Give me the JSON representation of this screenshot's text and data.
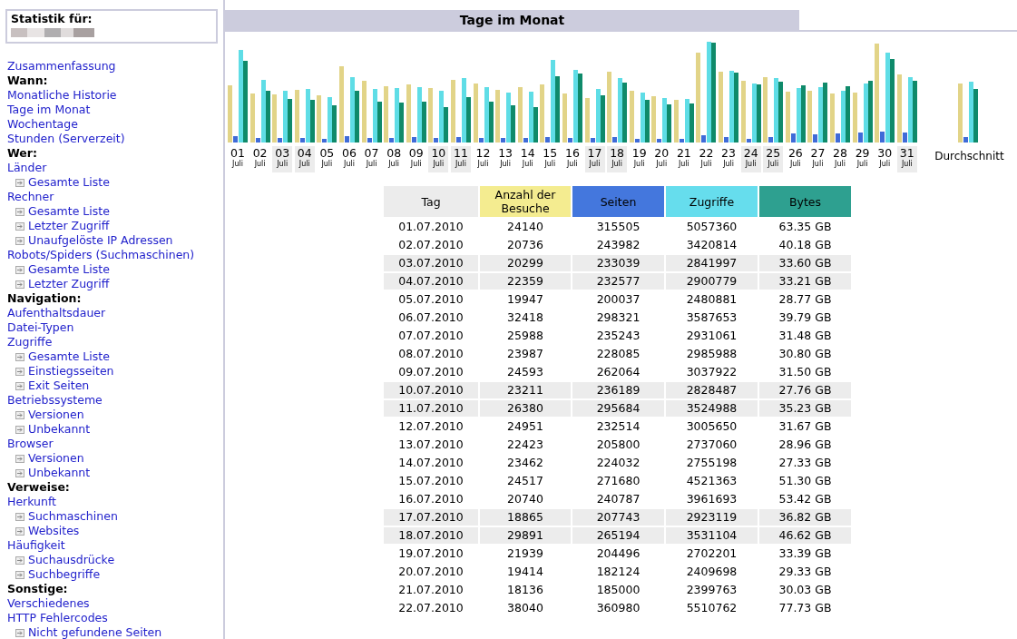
{
  "sidebar": {
    "title": "Statistik für:",
    "items": [
      {
        "kind": "link",
        "label": "Zusammenfassung"
      },
      {
        "kind": "heading",
        "label": "Wann:"
      },
      {
        "kind": "link",
        "label": "Monatliche Historie"
      },
      {
        "kind": "link",
        "label": "Tage im Monat"
      },
      {
        "kind": "link",
        "label": "Wochentage"
      },
      {
        "kind": "link",
        "label": "Stunden (Serverzeit)"
      },
      {
        "kind": "heading",
        "label": "Wer:"
      },
      {
        "kind": "link",
        "label": "Länder"
      },
      {
        "kind": "sublink",
        "label": "Gesamte Liste"
      },
      {
        "kind": "link",
        "label": "Rechner"
      },
      {
        "kind": "sublink",
        "label": "Gesamte Liste"
      },
      {
        "kind": "sublink",
        "label": "Letzter Zugriff"
      },
      {
        "kind": "sublink",
        "label": "Unaufgelöste IP Adressen"
      },
      {
        "kind": "link",
        "label": "Robots/Spiders (Suchmaschinen)"
      },
      {
        "kind": "sublink",
        "label": "Gesamte Liste"
      },
      {
        "kind": "sublink",
        "label": "Letzter Zugriff"
      },
      {
        "kind": "heading",
        "label": "Navigation:"
      },
      {
        "kind": "link",
        "label": "Aufenthaltsdauer"
      },
      {
        "kind": "link",
        "label": "Datei-Typen"
      },
      {
        "kind": "link",
        "label": "Zugriffe"
      },
      {
        "kind": "sublink",
        "label": "Gesamte Liste"
      },
      {
        "kind": "sublink",
        "label": "Einstiegsseiten"
      },
      {
        "kind": "sublink",
        "label": "Exit Seiten"
      },
      {
        "kind": "link",
        "label": "Betriebssysteme"
      },
      {
        "kind": "sublink",
        "label": "Versionen"
      },
      {
        "kind": "sublink",
        "label": "Unbekannt"
      },
      {
        "kind": "link",
        "label": "Browser"
      },
      {
        "kind": "sublink",
        "label": "Versionen"
      },
      {
        "kind": "sublink",
        "label": "Unbekannt"
      },
      {
        "kind": "heading",
        "label": "Verweise:"
      },
      {
        "kind": "link",
        "label": "Herkunft"
      },
      {
        "kind": "sublink",
        "label": "Suchmaschinen"
      },
      {
        "kind": "sublink",
        "label": "Websites"
      },
      {
        "kind": "link",
        "label": "Häufigkeit"
      },
      {
        "kind": "sublink",
        "label": "Suchausdrücke"
      },
      {
        "kind": "sublink",
        "label": "Suchbegriffe"
      },
      {
        "kind": "heading",
        "label": "Sonstige:"
      },
      {
        "kind": "link",
        "label": "Verschiedenes"
      },
      {
        "kind": "link",
        "label": "HTTP Fehlercodes"
      },
      {
        "kind": "sublink",
        "label": "Nicht gefundene Seiten"
      }
    ]
  },
  "section_title": "Tage im Monat",
  "chart": {
    "days": [
      {
        "day": "01",
        "month": "Juli",
        "weekend": false
      },
      {
        "day": "02",
        "month": "Juli",
        "weekend": false
      },
      {
        "day": "03",
        "month": "Juli",
        "weekend": true
      },
      {
        "day": "04",
        "month": "Juli",
        "weekend": true
      },
      {
        "day": "05",
        "month": "Juli",
        "weekend": false
      },
      {
        "day": "06",
        "month": "Juli",
        "weekend": false
      },
      {
        "day": "07",
        "month": "Juli",
        "weekend": false
      },
      {
        "day": "08",
        "month": "Juli",
        "weekend": false
      },
      {
        "day": "09",
        "month": "Juli",
        "weekend": false
      },
      {
        "day": "10",
        "month": "Juli",
        "weekend": true
      },
      {
        "day": "11",
        "month": "Juli",
        "weekend": true
      },
      {
        "day": "12",
        "month": "Juli",
        "weekend": false
      },
      {
        "day": "13",
        "month": "Juli",
        "weekend": false
      },
      {
        "day": "14",
        "month": "Juli",
        "weekend": false
      },
      {
        "day": "15",
        "month": "Juli",
        "weekend": false
      },
      {
        "day": "16",
        "month": "Juli",
        "weekend": false
      },
      {
        "day": "17",
        "month": "Juli",
        "weekend": true
      },
      {
        "day": "18",
        "month": "Juli",
        "weekend": true
      },
      {
        "day": "19",
        "month": "Juli",
        "weekend": false
      },
      {
        "day": "20",
        "month": "Juli",
        "weekend": false
      },
      {
        "day": "21",
        "month": "Juli",
        "weekend": false
      },
      {
        "day": "22",
        "month": "Juli",
        "weekend": false
      },
      {
        "day": "23",
        "month": "Juli",
        "weekend": false
      },
      {
        "day": "24",
        "month": "Juli",
        "weekend": true
      },
      {
        "day": "25",
        "month": "Juli",
        "weekend": true
      },
      {
        "day": "26",
        "month": "Juli",
        "weekend": false
      },
      {
        "day": "27",
        "month": "Juli",
        "weekend": false
      },
      {
        "day": "28",
        "month": "Juli",
        "weekend": false
      },
      {
        "day": "29",
        "month": "Juli",
        "weekend": false
      },
      {
        "day": "30",
        "month": "Juli",
        "weekend": false
      },
      {
        "day": "31",
        "month": "Juli",
        "weekend": true
      }
    ],
    "average_label": "Durchschnitt"
  },
  "table": {
    "columns": [
      "Tag",
      "Anzahl der Besuche",
      "Seiten",
      "Zugriffe",
      "Bytes"
    ],
    "rows": [
      {
        "weekend": false,
        "cells": [
          "01.07.2010",
          "24140",
          "315505",
          "5057360",
          "63.35 GB"
        ]
      },
      {
        "weekend": false,
        "cells": [
          "02.07.2010",
          "20736",
          "243982",
          "3420814",
          "40.18 GB"
        ]
      },
      {
        "weekend": true,
        "cells": [
          "03.07.2010",
          "20299",
          "233039",
          "2841997",
          "33.60 GB"
        ]
      },
      {
        "weekend": true,
        "cells": [
          "04.07.2010",
          "22359",
          "232577",
          "2900779",
          "33.21 GB"
        ]
      },
      {
        "weekend": false,
        "cells": [
          "05.07.2010",
          "19947",
          "200037",
          "2480881",
          "28.77 GB"
        ]
      },
      {
        "weekend": false,
        "cells": [
          "06.07.2010",
          "32418",
          "298321",
          "3587653",
          "39.79 GB"
        ]
      },
      {
        "weekend": false,
        "cells": [
          "07.07.2010",
          "25988",
          "235243",
          "2931061",
          "31.48 GB"
        ]
      },
      {
        "weekend": false,
        "cells": [
          "08.07.2010",
          "23987",
          "228085",
          "2985988",
          "30.80 GB"
        ]
      },
      {
        "weekend": false,
        "cells": [
          "09.07.2010",
          "24593",
          "262064",
          "3037922",
          "31.50 GB"
        ]
      },
      {
        "weekend": true,
        "cells": [
          "10.07.2010",
          "23211",
          "236189",
          "2828487",
          "27.76 GB"
        ]
      },
      {
        "weekend": true,
        "cells": [
          "11.07.2010",
          "26380",
          "295684",
          "3524988",
          "35.23 GB"
        ]
      },
      {
        "weekend": false,
        "cells": [
          "12.07.2010",
          "24951",
          "232514",
          "3005650",
          "31.67 GB"
        ]
      },
      {
        "weekend": false,
        "cells": [
          "13.07.2010",
          "22423",
          "205800",
          "2737060",
          "28.96 GB"
        ]
      },
      {
        "weekend": false,
        "cells": [
          "14.07.2010",
          "23462",
          "224032",
          "2755198",
          "27.33 GB"
        ]
      },
      {
        "weekend": false,
        "cells": [
          "15.07.2010",
          "24517",
          "271680",
          "4521363",
          "51.30 GB"
        ]
      },
      {
        "weekend": false,
        "cells": [
          "16.07.2010",
          "20740",
          "240787",
          "3961693",
          "53.42 GB"
        ]
      },
      {
        "weekend": true,
        "cells": [
          "17.07.2010",
          "18865",
          "207743",
          "2923119",
          "36.82 GB"
        ]
      },
      {
        "weekend": true,
        "cells": [
          "18.07.2010",
          "29891",
          "265194",
          "3531104",
          "46.62 GB"
        ]
      },
      {
        "weekend": false,
        "cells": [
          "19.07.2010",
          "21939",
          "204496",
          "2702201",
          "33.39 GB"
        ]
      },
      {
        "weekend": false,
        "cells": [
          "20.07.2010",
          "19414",
          "182124",
          "2409698",
          "29.33 GB"
        ]
      },
      {
        "weekend": false,
        "cells": [
          "21.07.2010",
          "18136",
          "185000",
          "2399763",
          "30.03 GB"
        ]
      },
      {
        "weekend": false,
        "cells": [
          "22.07.2010",
          "38040",
          "360980",
          "5510762",
          "77.73 GB"
        ]
      }
    ]
  }
}
